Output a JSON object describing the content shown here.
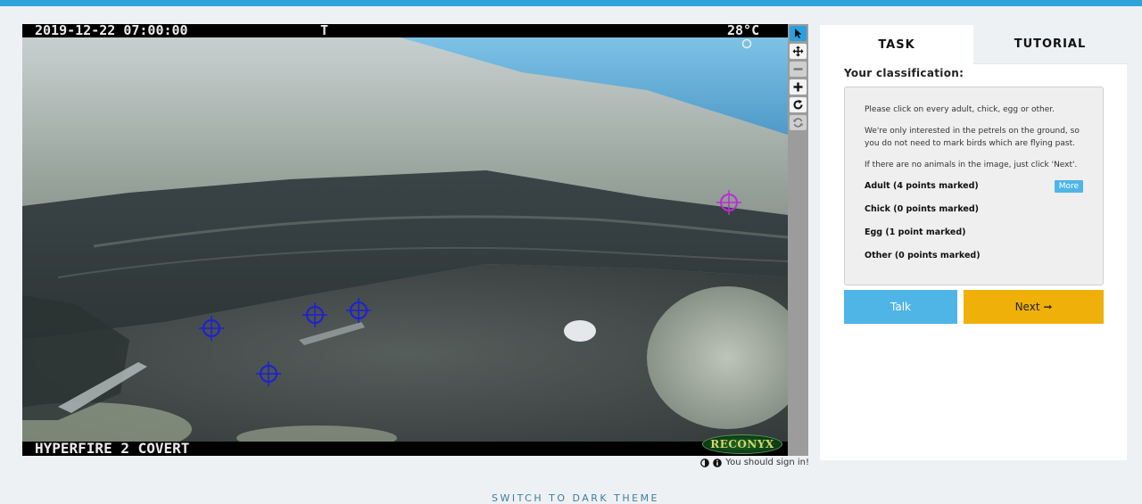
{
  "camera": {
    "date_time": "2019-12-22 07:00:00",
    "mode": "T",
    "moon_icon": "moon-phase-icon",
    "temperature": "28°C",
    "model": "HYPERFIRE 2 COVERT",
    "brand": "RECONYX"
  },
  "markers": {
    "adult_color": "#1f1fd6",
    "egg_color": "#c02ad6"
  },
  "toolbar": {
    "icons": [
      "pointer-icon",
      "move-icon",
      "zoom-out-icon",
      "zoom-in-icon",
      "rotate-icon",
      "reset-icon"
    ]
  },
  "viewer_footer": {
    "sign_in_text": "You should sign in!"
  },
  "theme": {
    "switch_label": "SWITCH TO DARK THEME"
  },
  "tabs": {
    "task": "TASK",
    "tutorial": "TUTORIAL"
  },
  "task": {
    "title": "Your classification:",
    "instructions": [
      "Please click on every adult, chick, egg or other.",
      "We're only interested in the petrels on the ground, so you do not need to mark birds which are flying past.",
      "If there are no animals in the image, just click 'Next'."
    ],
    "tools": [
      "Adult (4 points marked)",
      "Chick (0 points marked)",
      "Egg (1 point marked)",
      "Other (0 points marked)"
    ],
    "more_label": "More",
    "talk_label": "Talk",
    "next_label": "Next ➞"
  },
  "colors": {
    "banner": "#2fa3d8",
    "talk": "#4fb5e6",
    "next": "#efb00a"
  }
}
